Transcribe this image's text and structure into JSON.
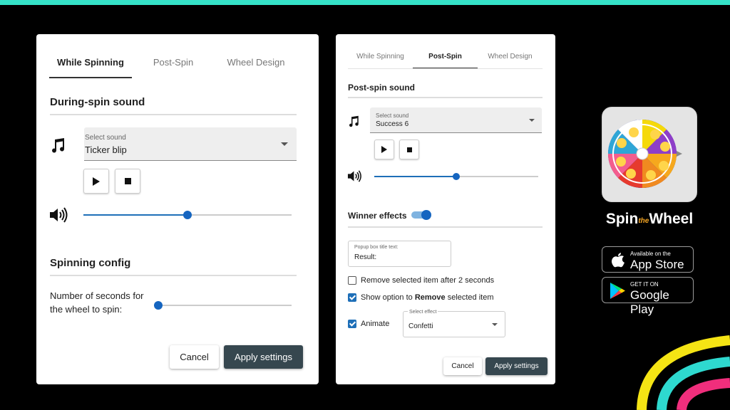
{
  "panel_left": {
    "tabs": [
      "While Spinning",
      "Post-Spin",
      "Wheel Design"
    ],
    "active_tab": "While Spinning",
    "sound_section_title": "During-spin sound",
    "select_sound_label": "Select sound",
    "select_sound_value": "Ticker blip",
    "volume_level": 0.5,
    "spin_section_title": "Spinning config",
    "seconds_label_line1": "Number of seconds for",
    "seconds_label_line2": "the wheel to spin:",
    "seconds_slider_level": 0.0,
    "cancel_label": "Cancel",
    "apply_label": "Apply settings"
  },
  "panel_right": {
    "tabs": [
      "While Spinning",
      "Post-Spin",
      "Wheel Design"
    ],
    "active_tab": "Post-Spin",
    "sound_section_title": "Post-spin sound",
    "select_sound_label": "Select sound",
    "select_sound_value": "Success 6",
    "volume_level": 0.5,
    "winner_effects_title": "Winner effects",
    "winner_effects_enabled": true,
    "popup_title_label": "Popup box title text:",
    "popup_title_value": "Result:",
    "remove_after_label": "Remove selected item after 2 seconds",
    "remove_after_checked": false,
    "show_option_prefix": "Show option to ",
    "show_option_bold": "Remove",
    "show_option_suffix": " selected item",
    "show_option_checked": true,
    "animate_label": "Animate",
    "animate_checked": true,
    "select_effect_label": "Select effect",
    "select_effect_value": "Confetti",
    "cancel_label": "Cancel",
    "apply_label": "Apply settings"
  },
  "branding": {
    "brand_part1": "Spin",
    "brand_part2": "the",
    "brand_part3": "Wheel",
    "appstore_small": "Available on the",
    "appstore_big": "App Store",
    "googleplay_small": "GET IT ON",
    "googleplay_big": "Google Play"
  },
  "colors": {
    "accent_blue": "#1e6fb8",
    "apply_button": "#36474f",
    "top_bar": "#35e2c8",
    "swirl_yellow": "#f5e414",
    "swirl_cyan": "#2ed9cf",
    "swirl_pink": "#f02e7c"
  }
}
